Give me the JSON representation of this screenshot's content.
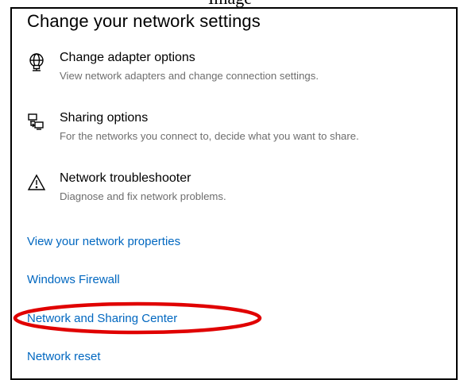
{
  "page": {
    "caption": "Image",
    "title": "Change your network settings"
  },
  "options": [
    {
      "title": "Change adapter options",
      "description": "View network adapters and change connection settings.",
      "icon": "network-adapter-icon"
    },
    {
      "title": "Sharing options",
      "description": "For the networks you connect to, decide what you want to share.",
      "icon": "sharing-icon"
    },
    {
      "title": "Network troubleshooter",
      "description": "Diagnose and fix network problems.",
      "icon": "warning-icon"
    }
  ],
  "links": [
    "View your network properties",
    "Windows Firewall",
    "Network and Sharing Center",
    "Network reset"
  ],
  "colors": {
    "link": "#0067c0",
    "highlight": "#e00000",
    "description": "#6e6e6e"
  }
}
